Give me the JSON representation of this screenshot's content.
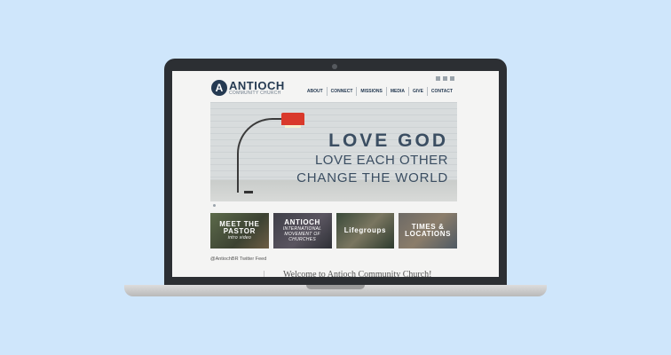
{
  "site": {
    "logo_letter": "A",
    "logo_name": "ANTIOCH",
    "logo_sub": "COMMUNITY CHURCH",
    "nav": [
      "ABOUT",
      "CONNECT",
      "MISSIONS",
      "MEDIA",
      "GIVE",
      "CONTACT"
    ]
  },
  "hero": {
    "line1": "LOVE GOD",
    "line2": "LOVE EACH OTHER",
    "line3": "CHANGE THE WORLD"
  },
  "tiles": [
    {
      "title": "MEET THE PASTOR",
      "sub": "intro video"
    },
    {
      "title": "ANTIOCH",
      "sub": "INTERNATIONAL MOVEMENT OF CHURCHES"
    },
    {
      "title": "Lifegroups",
      "sub": ""
    },
    {
      "title": "TIMES & LOCATIONS",
      "sub": ""
    }
  ],
  "twitter_feed": "@AntiochBR Twitter Feed",
  "welcome": "Welcome to Antioch Community Church!",
  "colors": {
    "background": "#cfe6fb",
    "brand": "#253a52",
    "lamp": "#d9392b"
  }
}
